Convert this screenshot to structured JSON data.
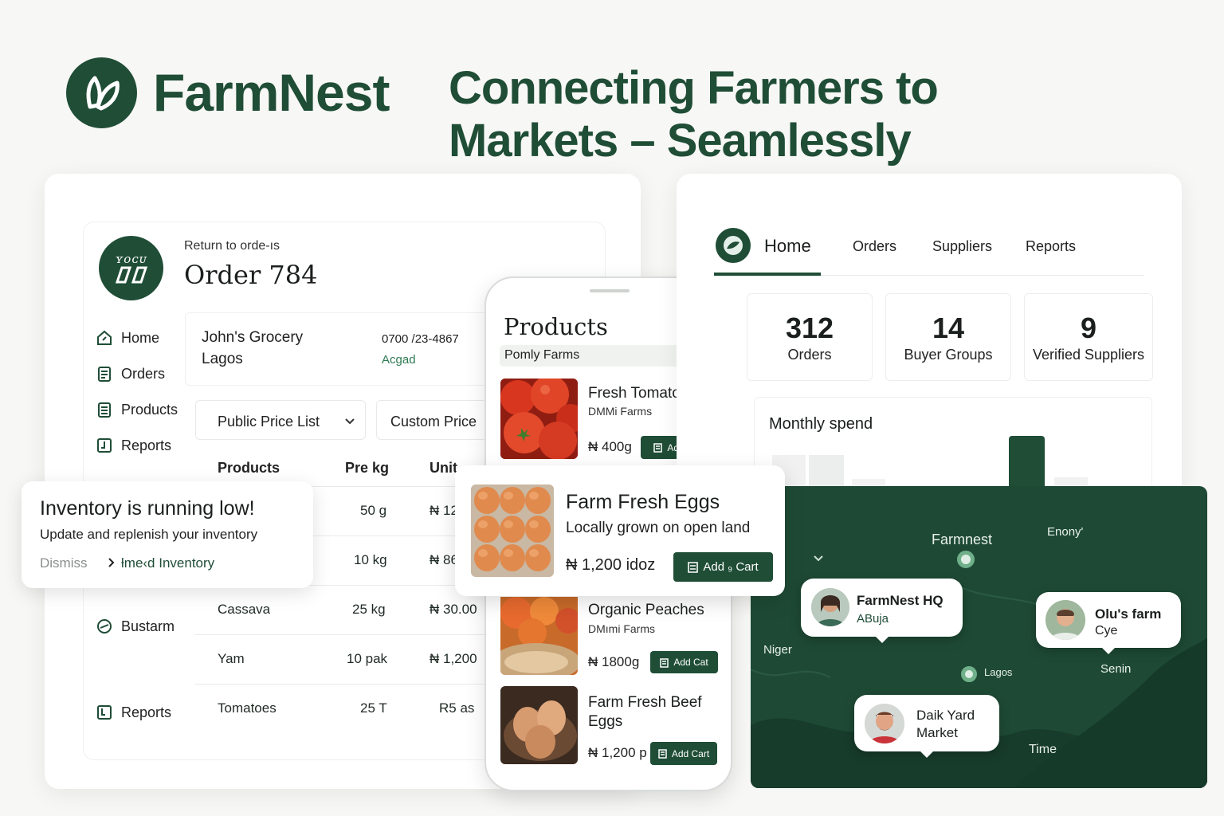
{
  "brand": {
    "name": "FarmNest",
    "tagline_line1": "Connecting Farmers to",
    "tagline_line2": "Markets – Seamlessly"
  },
  "order_panel": {
    "logo_text": "ʏᴏᴄᴜ",
    "back_link": "Return to orde-ıs",
    "title": "Order 784",
    "sidebar": [
      {
        "label": "Home",
        "icon": "home-icon"
      },
      {
        "label": "Orders",
        "icon": "orders-icon"
      },
      {
        "label": "Products",
        "icon": "products-icon"
      },
      {
        "label": "Reports",
        "icon": "reports-icon"
      }
    ],
    "sidebar_lower": [
      {
        "label": "Bustarm",
        "icon": "bustarm-icon"
      },
      {
        "label": "Reports",
        "icon": "reports-icon"
      }
    ],
    "customer": {
      "name": "John's Grocery",
      "city": "Lagos",
      "phone": "0700 /23-4867",
      "link": "Acgad"
    },
    "price_select": "Public Price List",
    "custom_price": "Custom Price",
    "table_headers": [
      "Products",
      "Pre kg",
      "Unit"
    ],
    "rows": [
      {
        "product": "",
        "qty": "50 g",
        "unit": "₦ 12"
      },
      {
        "product": "",
        "qty": "10 kg",
        "unit": "₦ 86"
      },
      {
        "product": "Cassava",
        "qty": "25 kg",
        "unit": "₦ 30.00"
      },
      {
        "product": "Yam",
        "qty": "10 pak",
        "unit": "₦ 1,200"
      },
      {
        "product": "Tomatoes",
        "qty": "25 T",
        "unit": "R5 as"
      }
    ]
  },
  "alert": {
    "title": "Inventory is running low!",
    "message": "Update and replenish your inventory",
    "dismiss": "Dismiss",
    "action": "ƚme‹d Inventory"
  },
  "phone": {
    "title": "Products",
    "subtitle": "Pomly Farms",
    "products": [
      {
        "name": "Fresh Tomatoes",
        "farm": "DMMi Farms",
        "price": "₦ 400g",
        "button": "Add Cart"
      },
      {
        "name": "Organic Peaches",
        "farm": "DMımi Farms",
        "price": "₦ 1800g",
        "button": "Add Cat"
      },
      {
        "name_line1": "Farm Fresh Beef",
        "name_line2": "Eggs",
        "price": "₦ 1,200 p",
        "button": "Add Cart"
      }
    ]
  },
  "featured": {
    "name": "Farm Fresh Eggs",
    "desc": "Locally grown on open land",
    "price": "₦ 1,200 idoz",
    "button": "Add ₉ Cart"
  },
  "dashboard": {
    "tabs": [
      "Home",
      "Orders",
      "Suppliers",
      "Reports"
    ],
    "active_tab": "Home",
    "stats": [
      {
        "value": "312",
        "label": "Orders"
      },
      {
        "value": "14",
        "label": "Buyer Groups"
      },
      {
        "value": "9",
        "label": "Verified Suppliers"
      }
    ],
    "chart_title": "Monthly spend"
  },
  "map": {
    "labels": {
      "farmnest": "Farmnest",
      "enony": "Enony'",
      "niger": "Niger",
      "lagos": "Lagos",
      "senin": "Senin",
      "time": "Time"
    },
    "pins": [
      {
        "title": "FarmNest HQ",
        "sub": "ABuja"
      },
      {
        "title": "Olu's farm",
        "sub": "Cye"
      },
      {
        "title": "Daik Yard",
        "sub": "Market"
      }
    ]
  },
  "colors": {
    "brand_green": "#1f4d36",
    "background": "#f7f7f5",
    "map_green": "#1e4a35"
  }
}
